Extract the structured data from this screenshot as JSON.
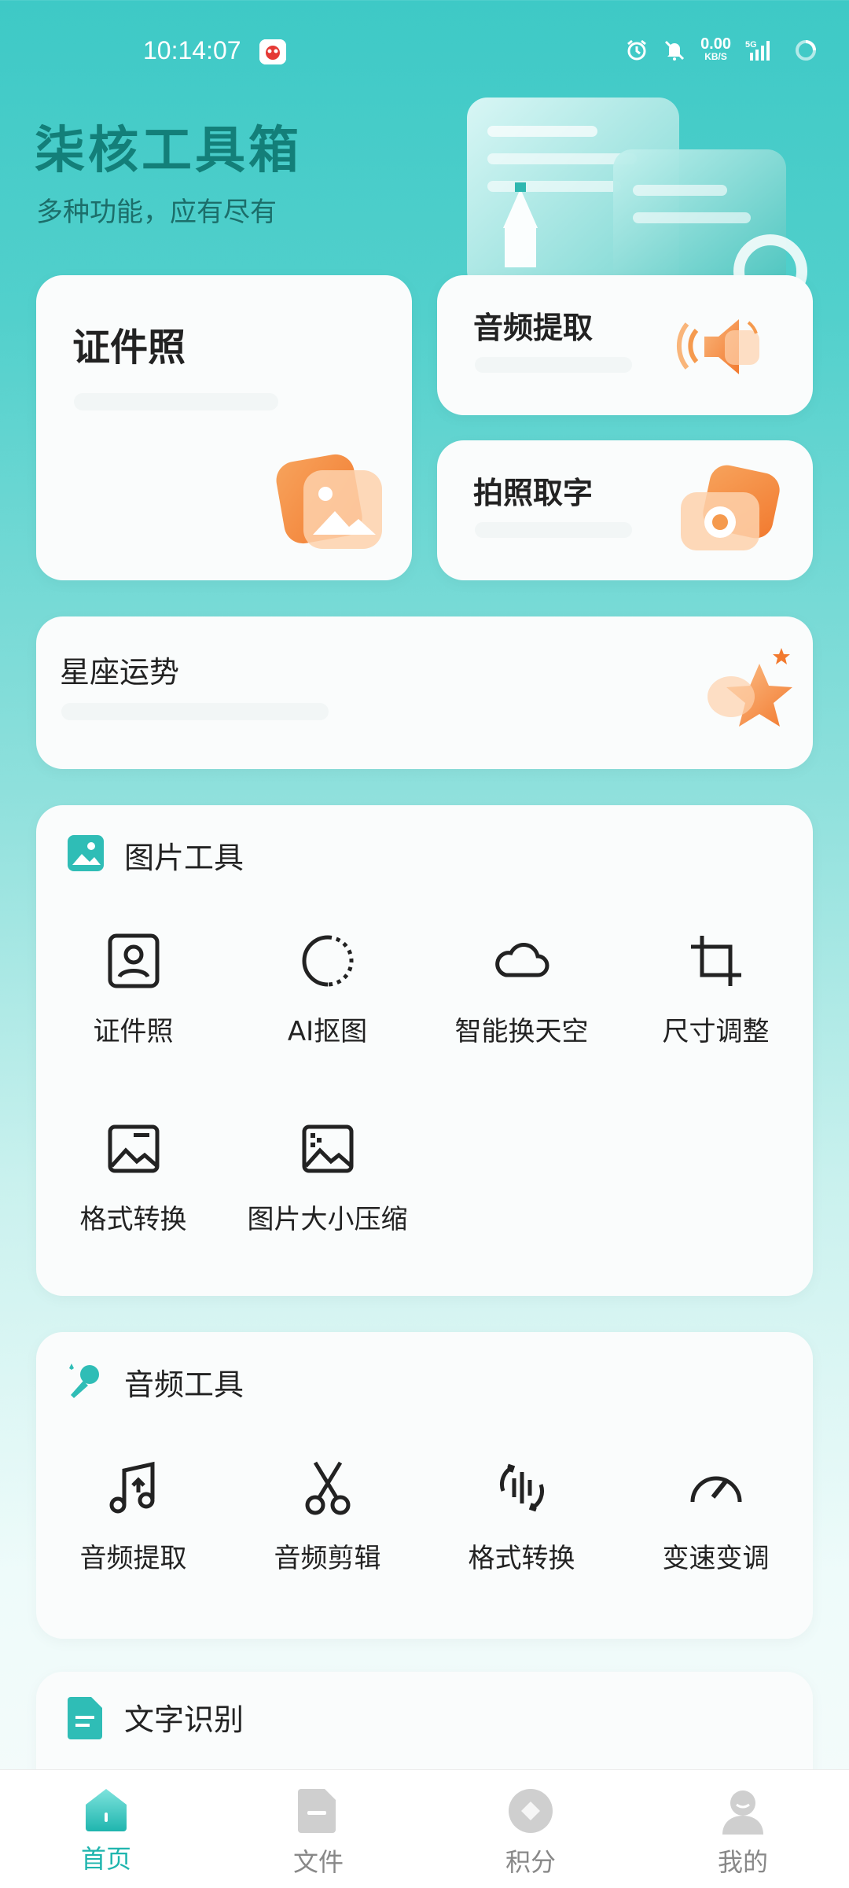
{
  "status_bar": {
    "time": "10:14:07",
    "net_speed": "0.00",
    "net_unit": "KB/S",
    "network": "5G"
  },
  "header": {
    "title": "柒核工具箱",
    "subtitle": "多种功能，应有尽有"
  },
  "feature_cards": {
    "id_photo": {
      "title": "证件照"
    },
    "audio_extract": {
      "title": "音频提取"
    },
    "photo_text": {
      "title": "拍照取字"
    },
    "horoscope": {
      "title": "星座运势"
    }
  },
  "sections": {
    "image_tools": {
      "title": "图片工具",
      "items": [
        {
          "label": "证件照",
          "icon": "id-photo-icon"
        },
        {
          "label": "AI抠图",
          "icon": "ai-cutout-icon"
        },
        {
          "label": "智能换天空",
          "icon": "cloud-icon"
        },
        {
          "label": "尺寸调整",
          "icon": "crop-icon"
        },
        {
          "label": "格式转换",
          "icon": "image-format-icon"
        },
        {
          "label": "图片大小压缩",
          "icon": "image-compress-icon"
        }
      ]
    },
    "audio_tools": {
      "title": "音频工具",
      "items": [
        {
          "label": "音频提取",
          "icon": "music-extract-icon"
        },
        {
          "label": "音频剪辑",
          "icon": "scissors-icon"
        },
        {
          "label": "格式转换",
          "icon": "audio-convert-icon"
        },
        {
          "label": "变速变调",
          "icon": "speedometer-icon"
        }
      ]
    },
    "text_recognition": {
      "title": "文字识别"
    }
  },
  "tabbar": {
    "items": [
      {
        "label": "首页",
        "icon": "home-icon",
        "active": true
      },
      {
        "label": "文件",
        "icon": "file-icon",
        "active": false
      },
      {
        "label": "积分",
        "icon": "points-icon",
        "active": false
      },
      {
        "label": "我的",
        "icon": "profile-icon",
        "active": false
      }
    ]
  },
  "colors": {
    "accent": "#1fb5ae",
    "title_teal": "#137f79",
    "orange": "#f59a4e"
  }
}
